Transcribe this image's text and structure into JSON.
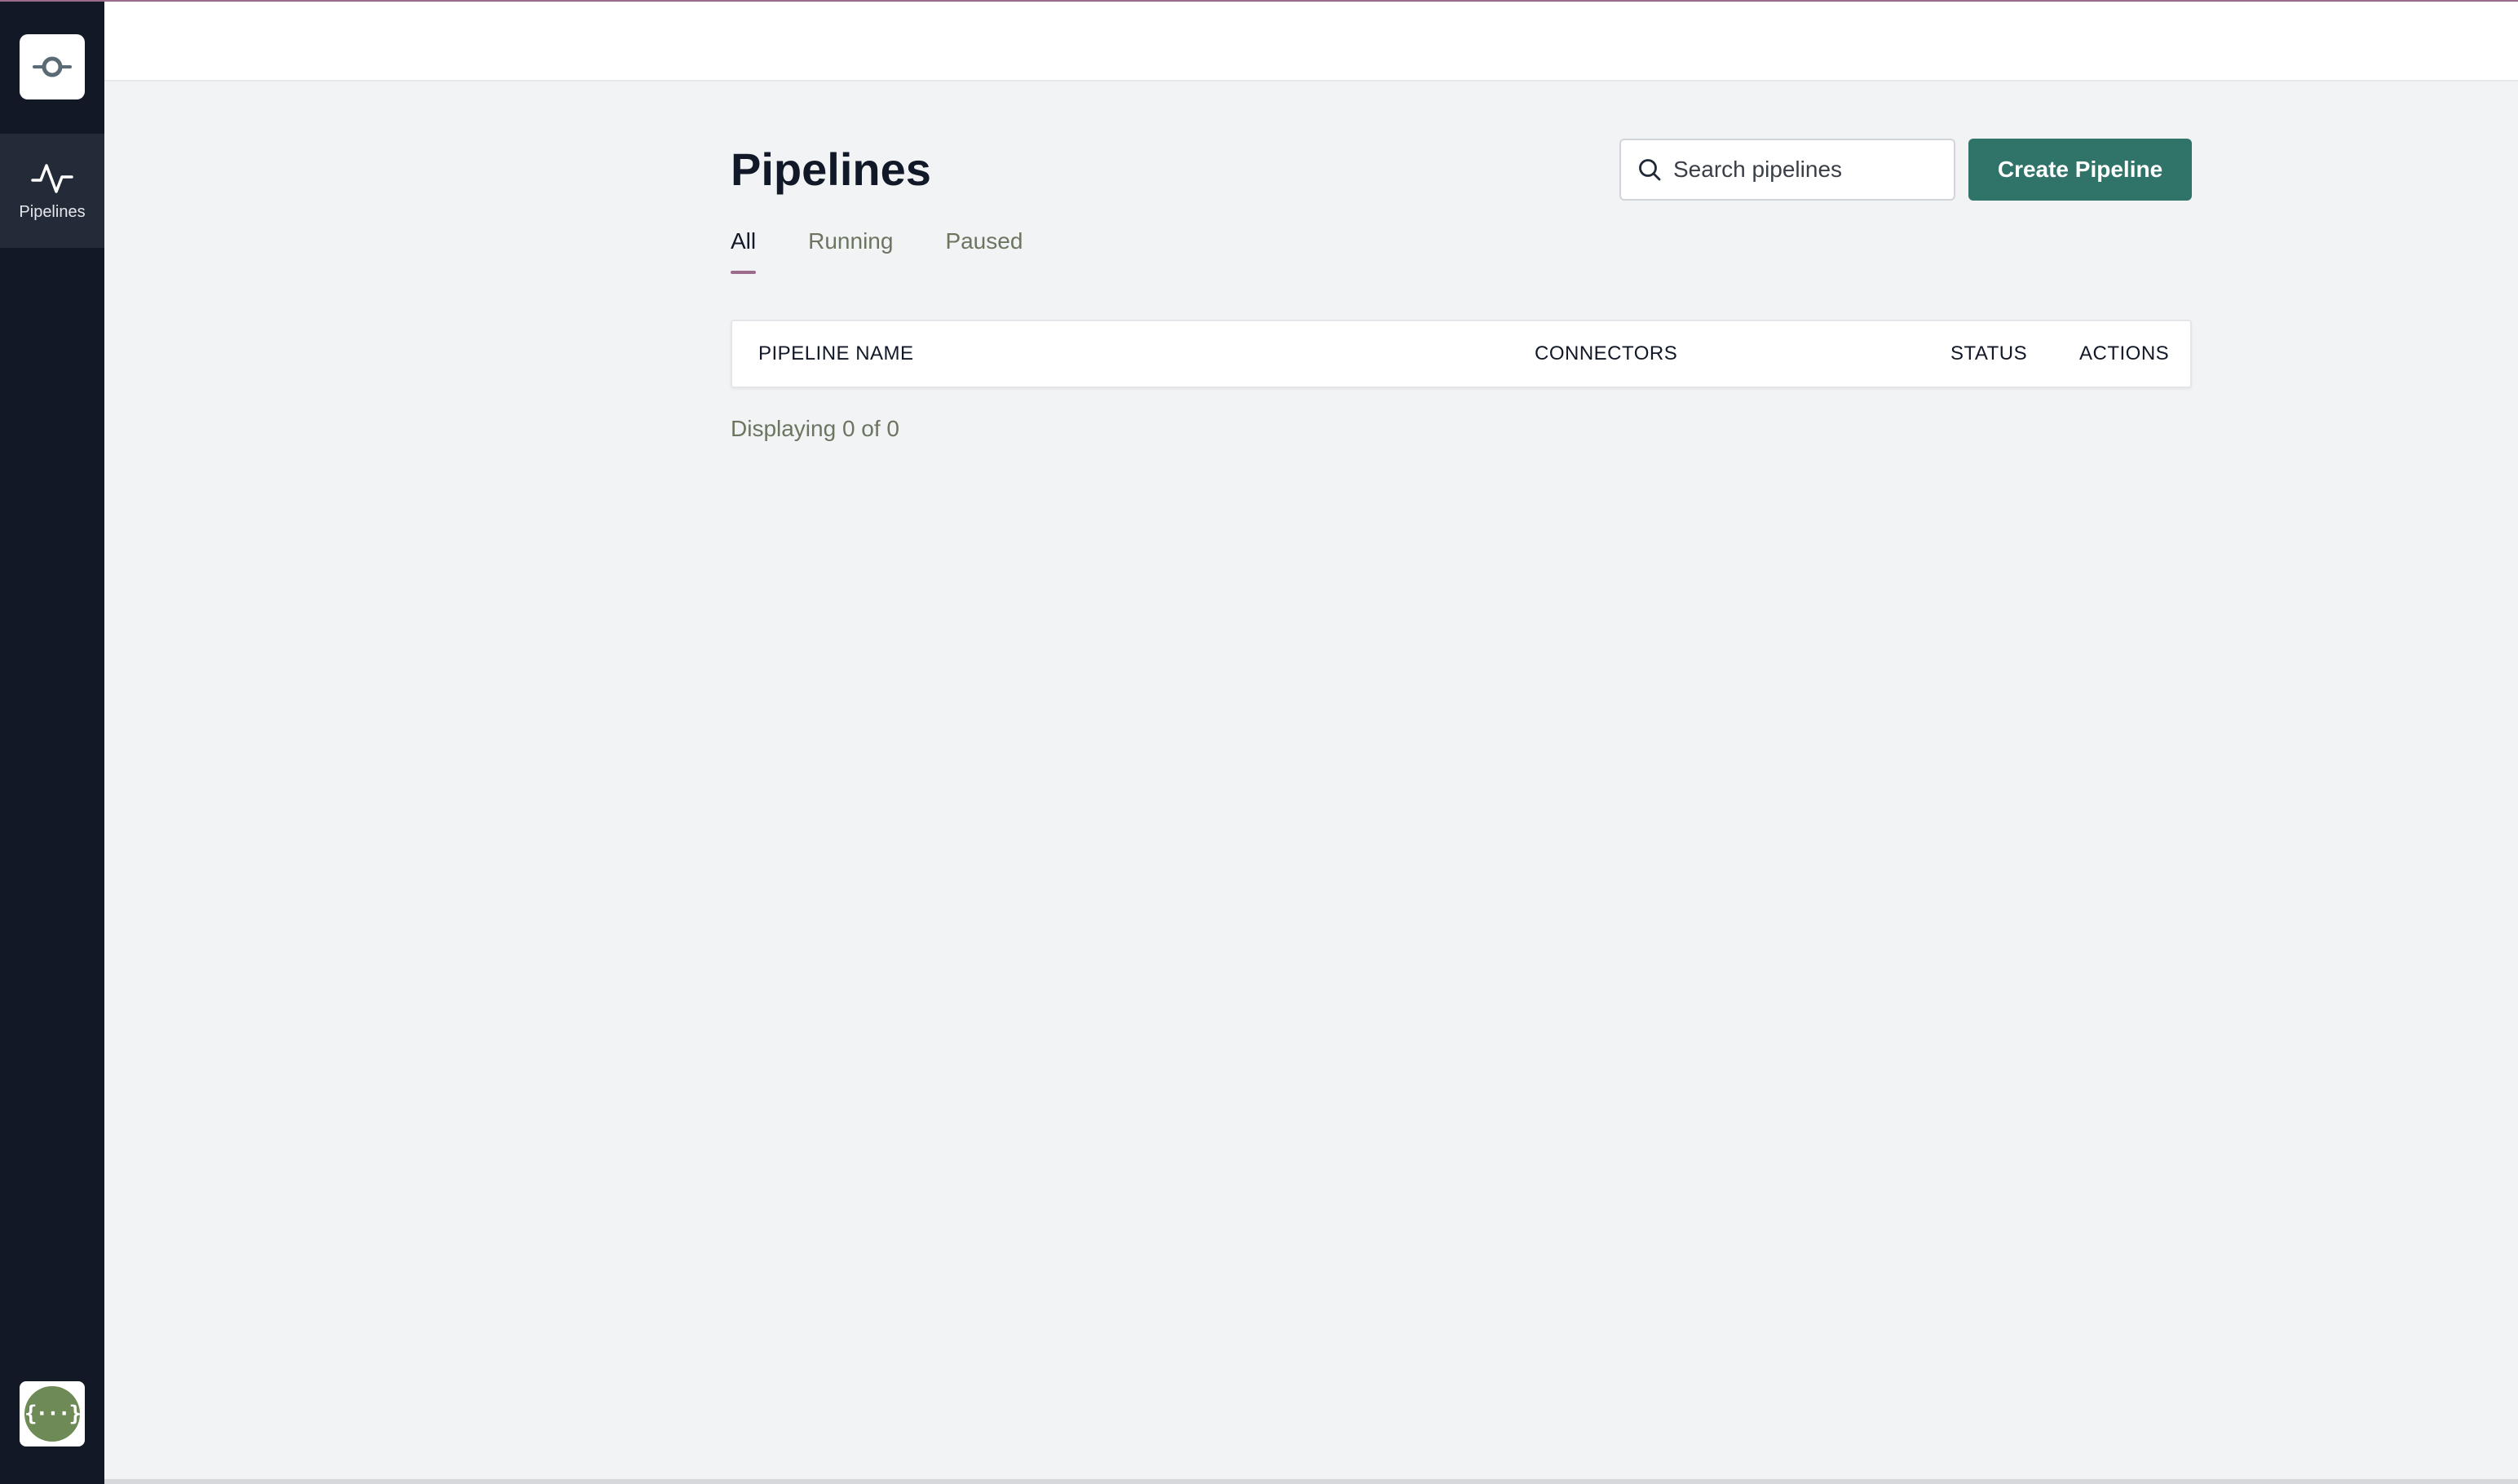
{
  "sidebar": {
    "logo_icon": "pipeline-node-icon",
    "nav": [
      {
        "label": "Pipelines",
        "icon": "activity-pulse-icon",
        "active": true
      }
    ],
    "avatar_icon": "braces-avatar-icon",
    "avatar_text": "{···}"
  },
  "header": {},
  "main": {
    "title": "Pipelines",
    "search": {
      "placeholder": "Search pipelines",
      "value": ""
    },
    "create_button_label": "Create Pipeline",
    "tabs": [
      {
        "label": "All",
        "active": true
      },
      {
        "label": "Running",
        "active": false
      },
      {
        "label": "Paused",
        "active": false
      }
    ],
    "table": {
      "columns": [
        "PIPELINE NAME",
        "CONNECTORS",
        "STATUS",
        "ACTIONS"
      ],
      "rows": []
    },
    "displaying_text": "Displaying 0 of 0"
  },
  "colors": {
    "sidebar_bg": "#121826",
    "accent_primary": "#2f7369",
    "tab_indicator": "#9b6b8e",
    "muted_text": "#6b7560"
  }
}
